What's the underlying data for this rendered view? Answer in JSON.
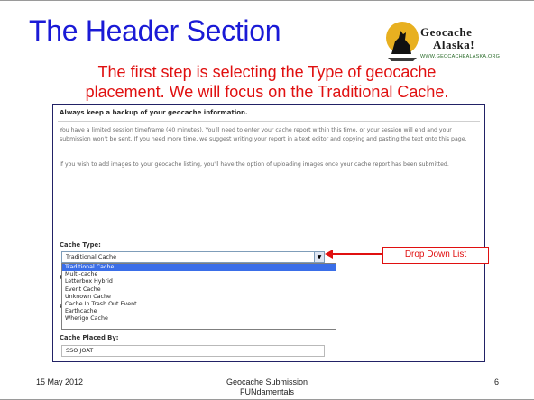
{
  "slide": {
    "title": "The Header Section",
    "subtitle_line1": "The first step is selecting the Type of geocache",
    "subtitle_line2": "placement.  We will focus on the Traditional Cache."
  },
  "logo": {
    "line1": "Geocache",
    "line2": "Alaska!",
    "url": "WWW.GEOCACHEALASKA.ORG"
  },
  "form": {
    "heading": "Always keep a backup of your geocache information.",
    "para1": "You have a limited session timeframe (40 minutes). You'll need to enter your cache report within this time, or your session will end and your submission won't be sent. If you need more time, we suggest writing your report in a text editor and copying and pasting the text onto this page.",
    "para2": "If you wish to add images to your geocache listing, you'll have the option of uploading images once your cache report has been submitted.",
    "cache_type_label": "Cache Type:",
    "cache_type_value": "Traditional Cache",
    "options": [
      "Traditional Cache",
      "Multi-cache",
      "Letterbox Hybrid",
      "Event Cache",
      "Unknown Cache",
      "Cache In Trash Out Event",
      "Earthcache",
      "Wherigo Cache"
    ],
    "hidden_label_1": "Ca",
    "hidden_label_2": "Ca",
    "hidden_label_3": "Ca",
    "placed_by_label": "Cache Placed By:",
    "placed_by_value": "SSO JOAT"
  },
  "callout": {
    "label": "Drop Down List"
  },
  "footer": {
    "date": "15 May 2012",
    "center_line1": "Geocache Submission",
    "center_line2": "FUNdamentals",
    "page": "6"
  },
  "colors": {
    "title": "#1a1ad6",
    "subtitle": "#e01010",
    "callout": "#e01010",
    "selected_option": "#3a6ee8"
  }
}
